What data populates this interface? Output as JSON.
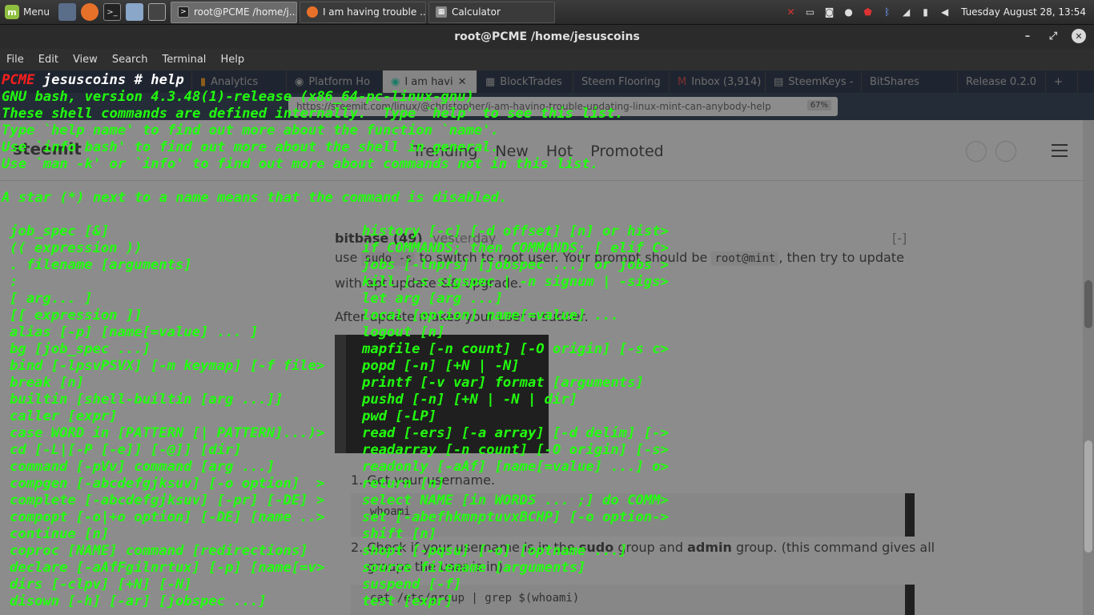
{
  "panel": {
    "menu_label": "Menu",
    "tasks": [
      {
        "label": "root@PCME /home/j...",
        "active": true
      },
      {
        "label": "I am having trouble ...",
        "active": false
      },
      {
        "label": "Calculator",
        "active": false
      }
    ],
    "clock": "Tuesday August 28, 13:54"
  },
  "window": {
    "title": "root@PCME /home/jesuscoins",
    "menu": [
      "File",
      "Edit",
      "View",
      "Search",
      "Terminal",
      "Help"
    ]
  },
  "browser": {
    "tabs": [
      "Analytics",
      "Platform Ho",
      "I am havi",
      "BlockTrades",
      "Steem Flooring",
      "Inbox (3,914)",
      "SteemKeys -",
      "BitShares",
      "Release 0.2.0"
    ],
    "url": "https://steemit.com/linux/@christopher/i-am-having-trouble-updating-linux-mint-can-anybody-help",
    "zoom": "67%",
    "nav_links": [
      "Trending",
      "New",
      "Hot",
      "Promoted"
    ],
    "logo": "steemit",
    "author": "bitbase (49)",
    "time": "yesterday",
    "collapse": "[-]",
    "p1_a": "use",
    "p1_code1": "sudo -s",
    "p1_b": "to switch to root user. Your prompt should be",
    "p1_code2": "root@mint",
    "p1_c": ", then try to update",
    "p2": "with apt update && upgrade.",
    "p3": "After update makes your user a sudoer.",
    "li1": "1. Get your username.",
    "li1_code": "whoami",
    "li2a": "2. Check if your username is in the",
    "li2b": "sudo",
    "li2c": "group and",
    "li2d": "admin",
    "li2e": "group. (this command gives all",
    "li2f": "groups the user is in)",
    "li2_code": "cat /etc/group | grep $(whoami)"
  },
  "terminal": {
    "prompt_host": "PCME",
    "prompt_user": "jesuscoins",
    "prompt_cmd": "# help",
    "header_lines": [
      "GNU bash, version 4.3.48(1)-release (x86_64-pc-linux-gnu)",
      "These shell commands are defined internally.  Type `help' to see this list.",
      "Type `help name' to find out more about the function `name'.",
      "Use `info bash' to find out more about the shell in general.",
      "Use `man -k' or `info' to find out more about commands not in this list.",
      "",
      "A star (*) next to a name means that the command is disabled.",
      ""
    ],
    "left_col": [
      "job_spec [&]",
      "(( expression ))",
      ". filename [arguments]",
      ":",
      "[ arg... ]",
      "[[ expression ]]",
      "alias [-p] [name[=value] ... ]",
      "bg [job_spec ...]",
      "bind [-lpsvPSVX] [-m keymap] [-f file>",
      "break [n]",
      "builtin [shell-builtin [arg ...]]",
      "caller [expr]",
      "case WORD in [PATTERN [| PATTERN]...)>",
      "cd [-L|[-P [-e]] [-@]] [dir]",
      "command [-pVv] command [arg ...]",
      "compgen [-abcdefgjksuv] [-o option]  >",
      "complete [-abcdefgjksuv] [-pr] [-DE] >",
      "compopt [-o|+o option] [-DE] [name ..>",
      "continue [n]",
      "coproc [NAME] command [redirections]",
      "declare [-aAfFgilnrtux] [-p] [name[=v>",
      "dirs [-clpv] [+N] [-N]",
      "disown [-h] [-ar] [jobspec ...]"
    ],
    "right_col": [
      "history [-c] [-d offset] [n] or hist>",
      "if COMMANDS; then COMMANDS; [ elif C>",
      "jobs [-lnprs] [jobspec ...] or jobs >",
      "kill [-s sigspec | -n signum | -sigs>",
      "let arg [arg ...]",
      "local [option] name[=value] ...",
      "logout [n]",
      "mapfile [-n count] [-O origin] [-s c>",
      "popd [-n] [+N | -N]",
      "printf [-v var] format [arguments]",
      "pushd [-n] [+N | -N | dir]",
      "pwd [-LP]",
      "read [-ers] [-a array] [-d delim] [->",
      "readarray [-n count] [-O origin] [-s>",
      "readonly [-aAf] [name[=value] ...] o>",
      "return [n]",
      "select NAME [in WORDS ... ;] do COMM>",
      "set [-abefhkmnptuvxBCHP] [-o option->",
      "shift [n]",
      "shopt [-pqsu] [-o] [optname ...]",
      "source filename [arguments]",
      "suspend [-f]",
      "test [expr]"
    ]
  },
  "colors": {
    "terminal_text": "#21ff0e",
    "prompt_host": "#ff1e1e",
    "prompt_user": "#ffffff"
  }
}
